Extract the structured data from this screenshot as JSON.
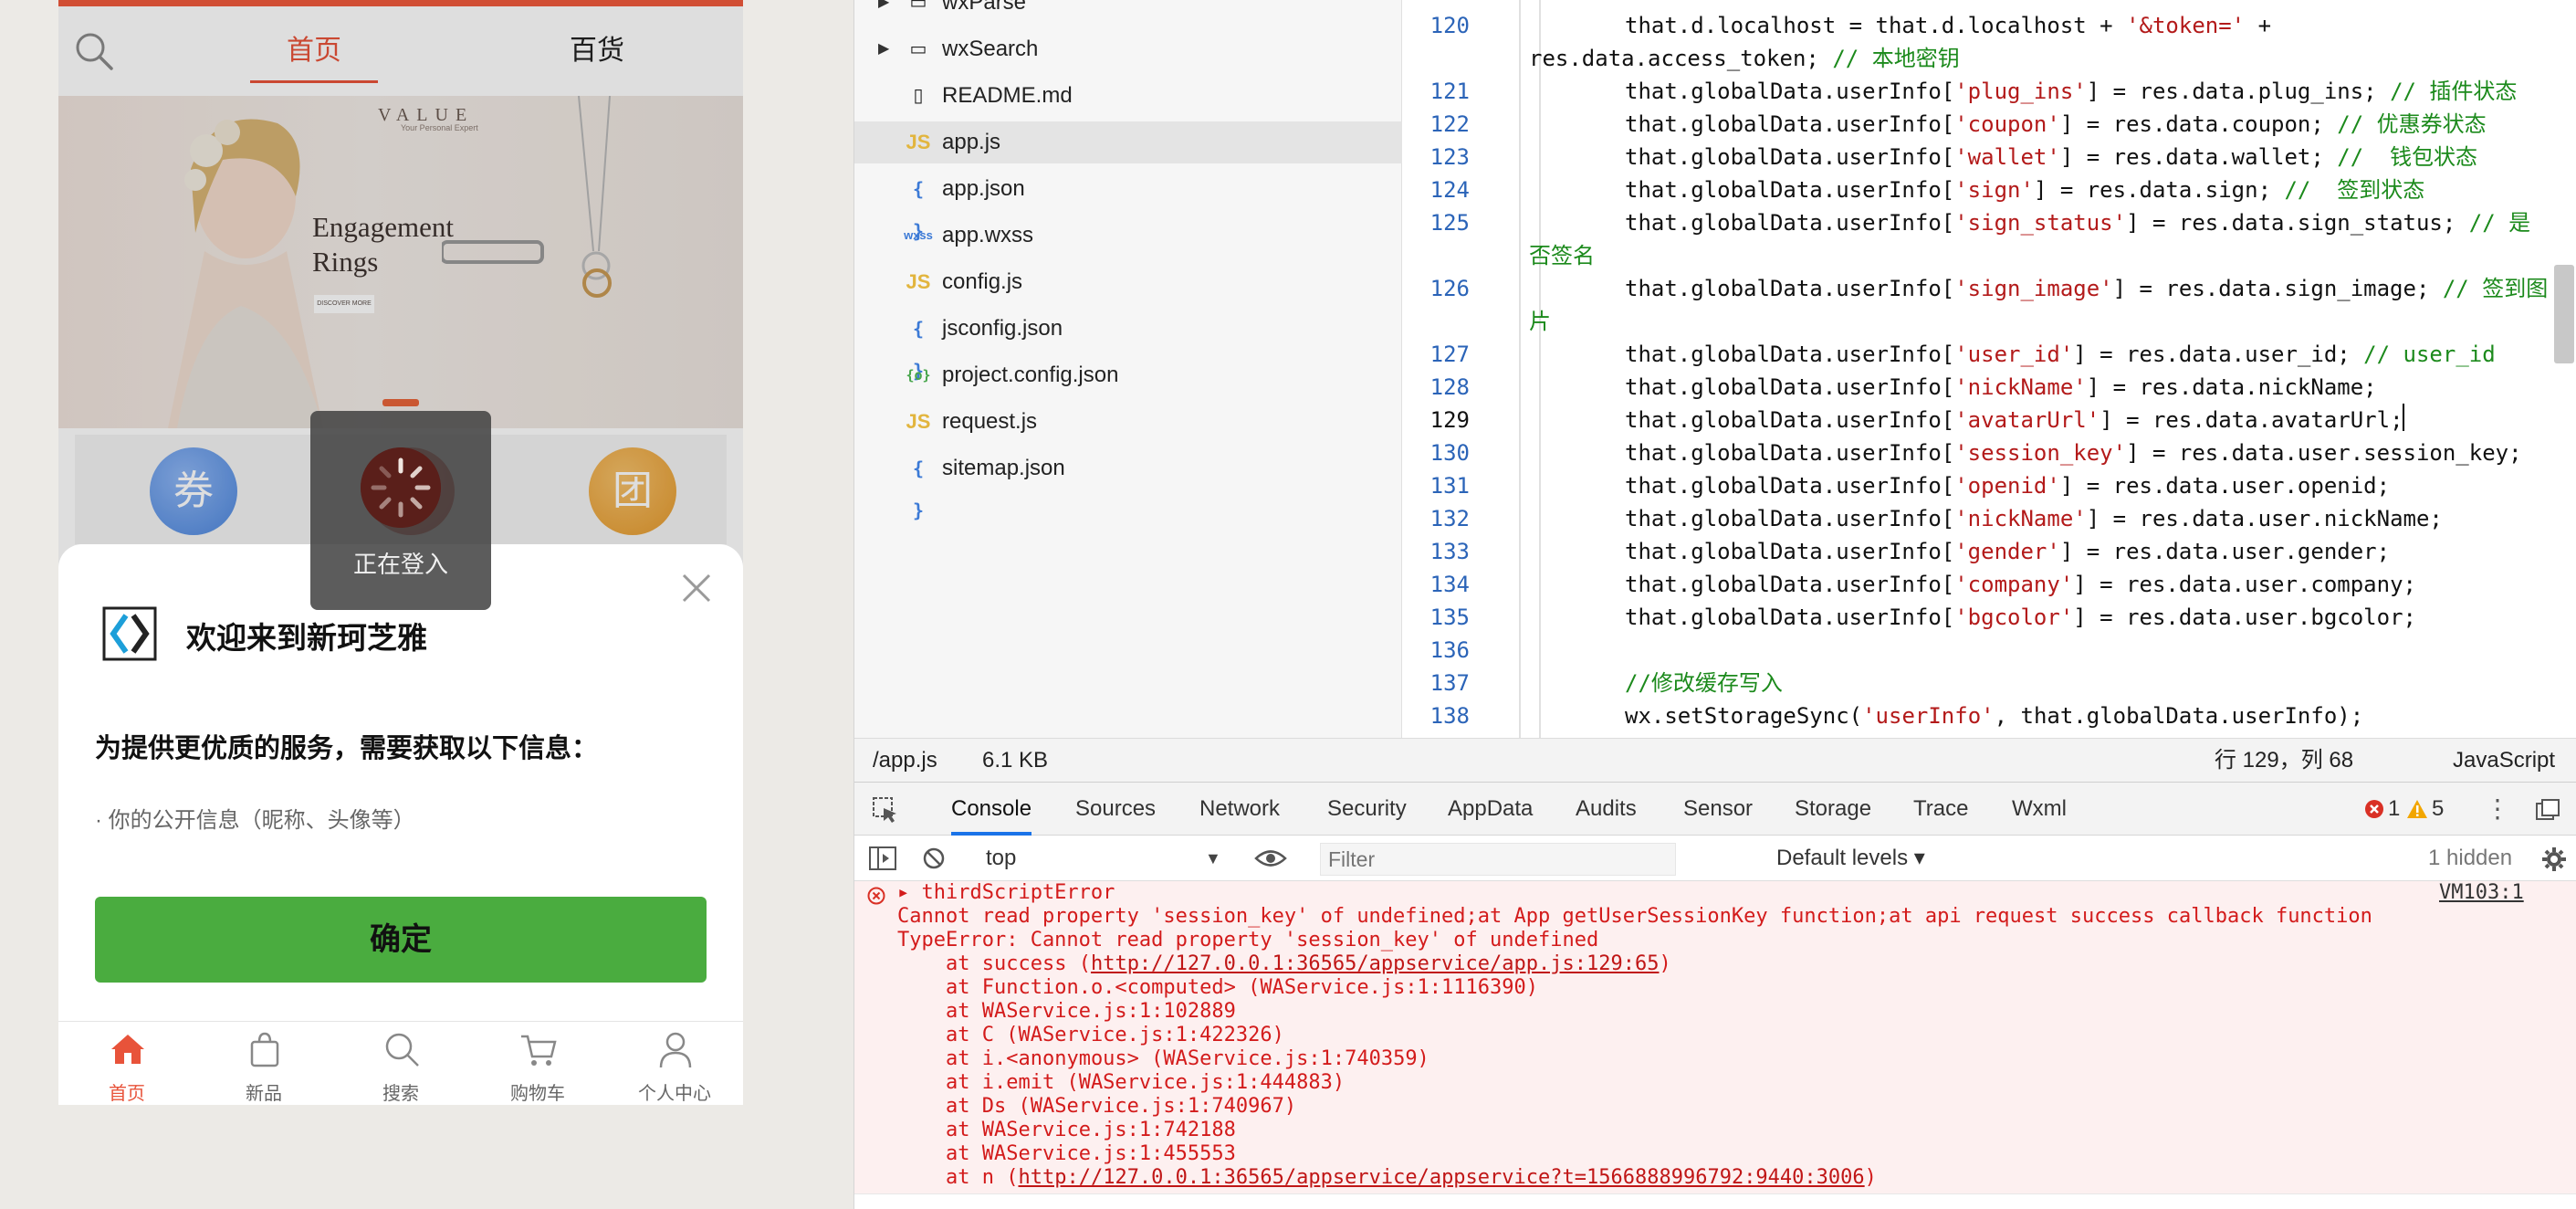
{
  "phone": {
    "tabs": [
      "首页",
      "百货"
    ],
    "banner": {
      "brand": "VALUE",
      "tagline": "Your Personal Expert",
      "title_line1": "Engagement",
      "title_line2": "Rings",
      "button": "DISCOVER MORE"
    },
    "icons": [
      "券",
      "团"
    ],
    "toast": "正在登入",
    "auth": {
      "welcome": "欢迎来到新珂芝雅",
      "need_info": "为提供更优质的服务，需要获取以下信息：",
      "item": "· 你的公开信息（昵称、头像等）",
      "confirm": "确定"
    },
    "tabbar": [
      "首页",
      "新品",
      "搜索",
      "购物车",
      "个人中心"
    ],
    "accent": "#e8533a",
    "confirm_color": "#4aac3f"
  },
  "filetree": [
    {
      "label": "wxParse",
      "type": "folder"
    },
    {
      "label": "wxSearch",
      "type": "folder"
    },
    {
      "label": "README.md",
      "type": "file"
    },
    {
      "label": "app.js",
      "type": "js"
    },
    {
      "label": "app.json",
      "type": "json"
    },
    {
      "label": "app.wxss",
      "type": "wxss"
    },
    {
      "label": "config.js",
      "type": "js"
    },
    {
      "label": "jsconfig.json",
      "type": "json"
    },
    {
      "label": "project.config.json",
      "type": "config"
    },
    {
      "label": "request.js",
      "type": "js"
    },
    {
      "label": "sitemap.json",
      "type": "json"
    }
  ],
  "editor": {
    "lines": [
      {
        "n": "120",
        "parts": [
          [
            "t",
            "that.d.localhost = that.d.localhost + "
          ],
          [
            "s",
            "'&token='"
          ],
          [
            "t",
            " +"
          ]
        ]
      },
      {
        "n": "",
        "wrap": true,
        "parts": [
          [
            "t",
            "res.data.access_token; "
          ],
          [
            "c",
            "// 本地密钥"
          ]
        ]
      },
      {
        "n": "121",
        "parts": [
          [
            "t",
            "that.globalData.userInfo["
          ],
          [
            "s",
            "'plug_ins'"
          ],
          [
            "t",
            "] = res.data.plug_ins; "
          ],
          [
            "c",
            "// 插件状态"
          ]
        ]
      },
      {
        "n": "122",
        "parts": [
          [
            "t",
            "that.globalData.userInfo["
          ],
          [
            "s",
            "'coupon'"
          ],
          [
            "t",
            "] = res.data.coupon; "
          ],
          [
            "c",
            "// 优惠券状态"
          ]
        ]
      },
      {
        "n": "123",
        "parts": [
          [
            "t",
            "that.globalData.userInfo["
          ],
          [
            "s",
            "'wallet'"
          ],
          [
            "t",
            "] = res.data.wallet; "
          ],
          [
            "c",
            "//  钱包状态"
          ]
        ]
      },
      {
        "n": "124",
        "parts": [
          [
            "t",
            "that.globalData.userInfo["
          ],
          [
            "s",
            "'sign'"
          ],
          [
            "t",
            "] = res.data.sign; "
          ],
          [
            "c",
            "//  签到状态"
          ]
        ]
      },
      {
        "n": "125",
        "parts": [
          [
            "t",
            "that.globalData.userInfo["
          ],
          [
            "s",
            "'sign_status'"
          ],
          [
            "t",
            "] = res.data.sign_status; "
          ],
          [
            "c",
            "// 是"
          ]
        ]
      },
      {
        "n": "",
        "wrap": true,
        "parts": [
          [
            "c",
            "否签名"
          ]
        ]
      },
      {
        "n": "126",
        "parts": [
          [
            "t",
            "that.globalData.userInfo["
          ],
          [
            "s",
            "'sign_image'"
          ],
          [
            "t",
            "] = res.data.sign_image; "
          ],
          [
            "c",
            "// 签到图"
          ]
        ]
      },
      {
        "n": "",
        "wrap": true,
        "parts": [
          [
            "c",
            "片"
          ]
        ]
      },
      {
        "n": "127",
        "parts": [
          [
            "t",
            "that.globalData.userInfo["
          ],
          [
            "s",
            "'user_id'"
          ],
          [
            "t",
            "] = res.data.user_id; "
          ],
          [
            "c",
            "// user_id"
          ]
        ]
      },
      {
        "n": "128",
        "parts": [
          [
            "t",
            "that.globalData.userInfo["
          ],
          [
            "s",
            "'nickName'"
          ],
          [
            "t",
            "] = res.data.nickName;"
          ]
        ]
      },
      {
        "n": "129",
        "cur": true,
        "parts": [
          [
            "t",
            "that.globalData.userInfo["
          ],
          [
            "s",
            "'avatarUrl'"
          ],
          [
            "t",
            "] = res.data.avatarUrl;"
          ]
        ]
      },
      {
        "n": "130",
        "parts": [
          [
            "t",
            "that.globalData.userInfo["
          ],
          [
            "s",
            "'session_key'"
          ],
          [
            "t",
            "] = res.data.user.session_key;"
          ]
        ]
      },
      {
        "n": "131",
        "parts": [
          [
            "t",
            "that.globalData.userInfo["
          ],
          [
            "s",
            "'openid'"
          ],
          [
            "t",
            "] = res.data.user.openid;"
          ]
        ]
      },
      {
        "n": "132",
        "parts": [
          [
            "t",
            "that.globalData.userInfo["
          ],
          [
            "s",
            "'nickName'"
          ],
          [
            "t",
            "] = res.data.user.nickName;"
          ]
        ]
      },
      {
        "n": "133",
        "parts": [
          [
            "t",
            "that.globalData.userInfo["
          ],
          [
            "s",
            "'gender'"
          ],
          [
            "t",
            "] = res.data.user.gender;"
          ]
        ]
      },
      {
        "n": "134",
        "parts": [
          [
            "t",
            "that.globalData.userInfo["
          ],
          [
            "s",
            "'company'"
          ],
          [
            "t",
            "] = res.data.user.company;"
          ]
        ]
      },
      {
        "n": "135",
        "parts": [
          [
            "t",
            "that.globalData.userInfo["
          ],
          [
            "s",
            "'bgcolor'"
          ],
          [
            "t",
            "] = res.data.user.bgcolor;"
          ]
        ]
      },
      {
        "n": "136",
        "parts": []
      },
      {
        "n": "137",
        "parts": [
          [
            "c",
            "//修改缓存写入"
          ]
        ]
      },
      {
        "n": "138",
        "parts": [
          [
            "t",
            "wx.setStorageSync("
          ],
          [
            "s",
            "'userInfo'"
          ],
          [
            "t",
            ", that.globalData.userInfo);"
          ]
        ]
      }
    ]
  },
  "status": {
    "file": "/app.js",
    "size": "6.1 KB",
    "position": "行 129，列 68",
    "lang": "JavaScript"
  },
  "devtools": {
    "tabs": [
      "Console",
      "Sources",
      "Network",
      "Security",
      "AppData",
      "Audits",
      "Sensor",
      "Storage",
      "Trace",
      "Wxml"
    ],
    "errors": "1",
    "warnings": "5",
    "context": "top",
    "filter_placeholder": "Filter",
    "levels": "Default levels ▾",
    "hidden": "1 hidden",
    "source": "VM103:1",
    "lines": [
      "▸ thirdScriptError",
      "Cannot read property 'session_key' of undefined;at App getUserSessionKey function;at api request success callback function",
      "TypeError: Cannot read property 'session_key' of undefined",
      "at success (|http://127.0.0.1:36565/appservice/app.js:129:65|)",
      "at Function.o.<computed> (WAService.js:1:1116390)",
      "at WAService.js:1:102889",
      "at C (WAService.js:1:422326)",
      "at i.<anonymous> (WAService.js:1:740359)",
      "at i.emit (WAService.js:1:444883)",
      "at Ds (WAService.js:1:740967)",
      "at WAService.js:1:742188",
      "at WAService.js:1:455553",
      "at n (|http://127.0.0.1:36565/appservice/appservice?t=1566888996792:9440:3006|)"
    ]
  }
}
